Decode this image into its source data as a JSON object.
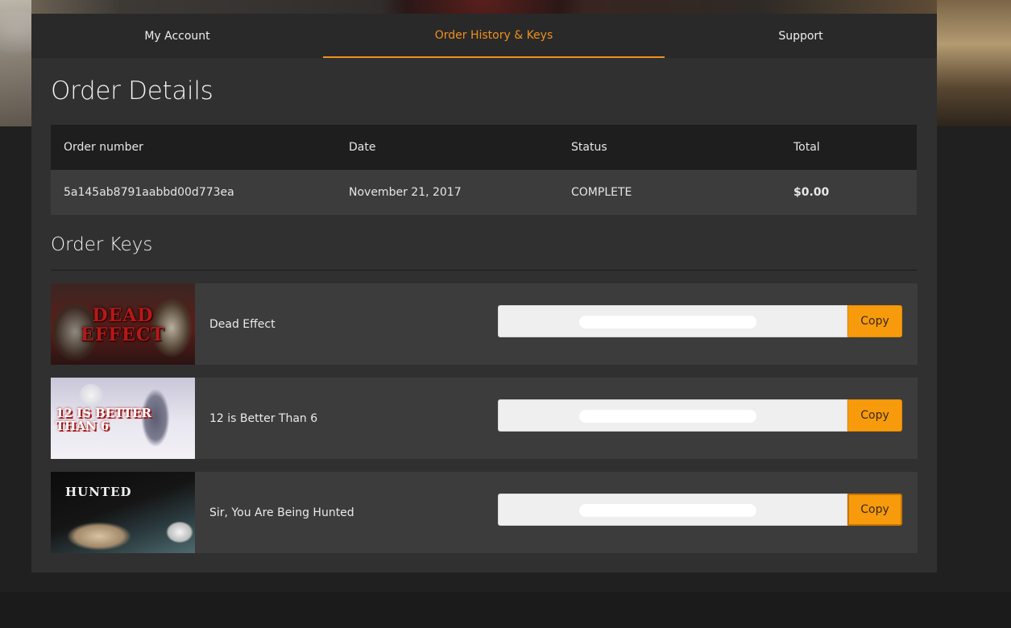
{
  "tabs": [
    {
      "label": "My Account",
      "active": false
    },
    {
      "label": "Order History & Keys",
      "active": true
    },
    {
      "label": "Support",
      "active": false
    }
  ],
  "accent_color": "#f0901f",
  "button_color": "#f79b0c",
  "order_details": {
    "title": "Order Details",
    "columns": [
      "Order number",
      "Date",
      "Status",
      "Total"
    ],
    "row": {
      "order_number": "5a145ab8791aabbd00d773ea",
      "date": "November 21, 2017",
      "status": "COMPLETE",
      "total": "$0.00"
    }
  },
  "order_keys": {
    "title": "Order Keys",
    "items": [
      {
        "game": "Dead Effect",
        "logo_text": "DEAD EFFECT",
        "copy_label": "Copy"
      },
      {
        "game": "12 is Better Than 6",
        "logo_text": "12 IS BETTER THAN 6",
        "copy_label": "Copy"
      },
      {
        "game": "Sir, You Are Being Hunted",
        "logo_text": "HUNTED",
        "copy_label": "Copy"
      }
    ]
  }
}
